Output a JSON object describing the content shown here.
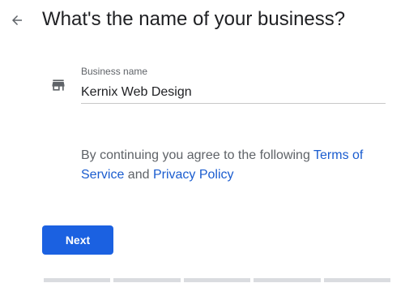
{
  "header": {
    "back_icon": "arrow-back-icon",
    "title": "What's the name of your business?"
  },
  "form": {
    "field_icon": "storefront-icon",
    "business_name_label": "Business name",
    "business_name_value": "Kernix Web Design"
  },
  "legal": {
    "prefix": "By continuing you agree to the following ",
    "terms_link": "Terms of Service",
    "conjunction": " and ",
    "privacy_link": "Privacy Policy"
  },
  "actions": {
    "next_label": "Next"
  },
  "progress": {
    "step_count": 5,
    "completed_steps": 0
  },
  "colors": {
    "accent": "#1b61e1",
    "link": "#1a5ccf",
    "progress_track": "#dadce0"
  }
}
